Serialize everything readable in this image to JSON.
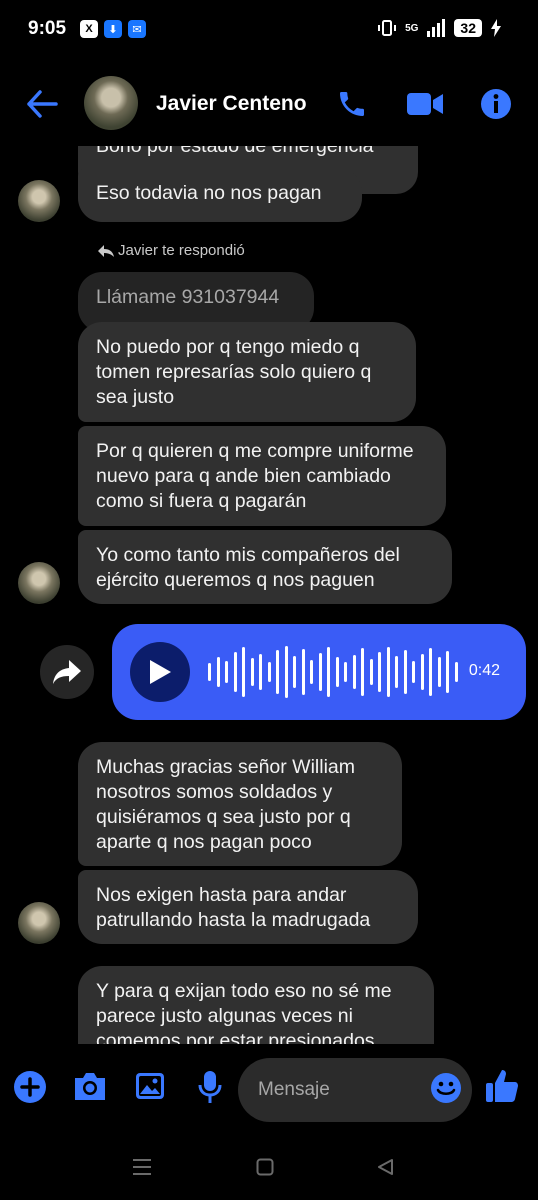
{
  "status_bar": {
    "time": "9:05",
    "app_icons": [
      "X",
      "⬇",
      "✉"
    ],
    "network": "5G",
    "battery": "32"
  },
  "header": {
    "contact_name": "Javier Centeno",
    "accent_color": "#3a5cf6"
  },
  "chat": {
    "partial_message": "Bono por estado de emergencia",
    "messages": [
      "Eso todavia no nos pagan",
      "Llámame 931037944",
      "No puedo por q tengo miedo q tomen represarías solo quiero q sea justo",
      "Por q quieren q me compre uniforme nuevo para q ande bien cambiado como si fuera q pagarán",
      "Yo como tanto mis compañeros del ejército queremos q nos paguen",
      "Muchas gracias señor William nosotros somos soldados y quisiéramos q sea justo por q aparte q nos pagan poco",
      "Nos exigen hasta para andar patrullando hasta la madrugada",
      "Y para q exijan todo eso no sé me parece justo algunas veces ni comemos por estar presionados"
    ],
    "reply_note": "Javier te respondió",
    "voice_message": {
      "duration": "0:42"
    }
  },
  "composer": {
    "placeholder": "Mensaje"
  },
  "icons": {
    "back": "arrow-left-icon",
    "call": "phone-icon",
    "video": "video-camera-icon",
    "info": "info-icon",
    "plus": "plus-circle-icon",
    "camera": "camera-icon",
    "gallery": "image-icon",
    "mic": "microphone-icon",
    "emoji": "emoji-icon",
    "like": "thumbs-up-icon"
  }
}
